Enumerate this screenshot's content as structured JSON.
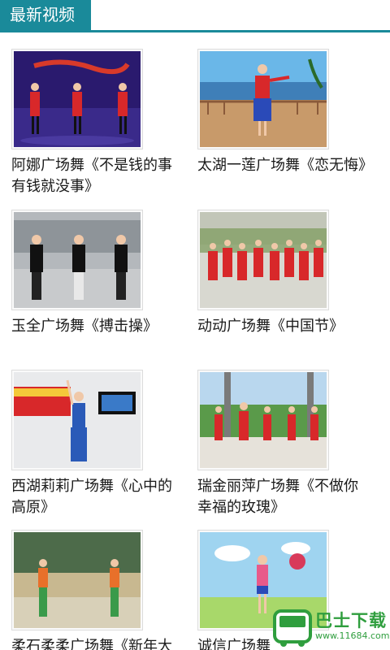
{
  "header": {
    "title": "最新视频"
  },
  "videos": [
    {
      "title": "阿娜广场舞《不是钱的事有钱就没事》",
      "thumb_bg": "#2a1a6e"
    },
    {
      "title": "太湖一莲广场舞《恋无悔》",
      "thumb_bg": "#6ab7e8"
    },
    {
      "title": "玉全广场舞《搏击操》",
      "thumb_bg": "#9aa0a6"
    },
    {
      "title": "动动广场舞《中国节》",
      "thumb_bg": "#d8d8d0"
    },
    {
      "title": "西湖莉莉广场舞《心中的高原》",
      "thumb_bg": "#e9eaec"
    },
    {
      "title": "瑞金丽萍广场舞《不做你幸福的玫瑰》",
      "thumb_bg": "#b9d7ee"
    },
    {
      "title": "柔石柔柔广场舞《新年大",
      "thumb_bg": "#4d6b4a"
    },
    {
      "title": "诚信广场舞",
      "thumb_bg": "#9fd4f0"
    }
  ],
  "watermark": {
    "name": "巴士下载",
    "url": "www.11684.com"
  }
}
